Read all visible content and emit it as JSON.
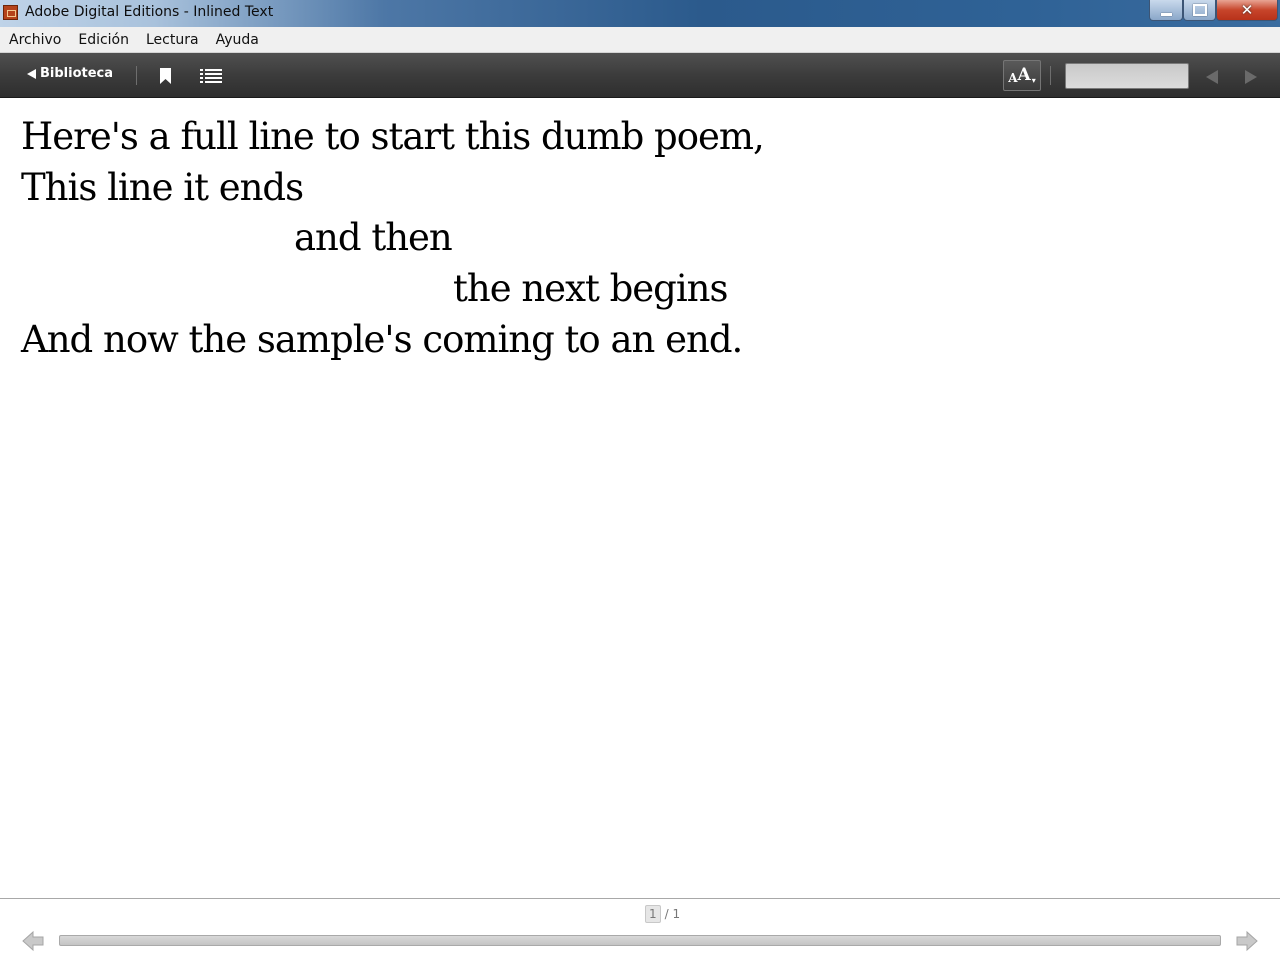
{
  "window": {
    "title": "Adobe Digital Editions - Inlined Text",
    "minimize_label": "",
    "close_label": "✕"
  },
  "menu": {
    "items": [
      "Archivo",
      "Edición",
      "Lectura",
      "Ayuda"
    ]
  },
  "toolbar": {
    "library_label": "Biblioteca",
    "font_small": "A",
    "font_big": "A",
    "font_caret": "▾",
    "search_value": "",
    "icons": [
      "back-triangle-icon",
      "bookmark-icon",
      "table-of-contents-icon",
      "font-size-icon",
      "previous-result-icon",
      "next-result-icon"
    ]
  },
  "content": {
    "lines": [
      "Here's a full line to start this dumb poem,",
      "This line it ends",
      "and then",
      "the next begins",
      "And now the sample's coming to an end."
    ]
  },
  "footer": {
    "page_current": "1",
    "page_total": "/ 1",
    "icons": [
      "previous-page-icon",
      "next-page-icon"
    ]
  },
  "colors": {
    "toolbar": "#3c3c3c",
    "titlebar_accent": "#2b5a8c",
    "close_button": "#c7452b"
  }
}
